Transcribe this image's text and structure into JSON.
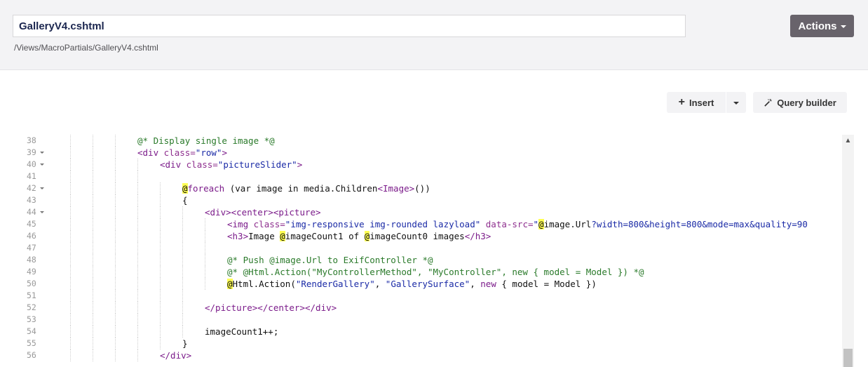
{
  "header": {
    "file_name": "GalleryV4.cshtml",
    "path": "/Views/MacroPartials/GalleryV4.cshtml",
    "actions_label": "Actions"
  },
  "toolbar": {
    "insert_label": "Insert",
    "query_builder_label": "Query builder"
  },
  "colors": {
    "header_bg": "#f3f3f5",
    "actions_bg": "#68636b",
    "comment": "#2a7a2a",
    "tag": "#7b1b8a",
    "string": "#1a2aa6",
    "razor_highlight": "#ffff55"
  },
  "editor": {
    "lines": [
      {
        "num": "38",
        "fold": false,
        "indent": 3,
        "tokens": [
          {
            "t": "@* Display single image *@",
            "c": "com"
          }
        ]
      },
      {
        "num": "39",
        "fold": true,
        "indent": 3,
        "tokens": [
          {
            "t": "<div ",
            "c": "tag"
          },
          {
            "t": "class=",
            "c": "attr"
          },
          {
            "t": "\"row\"",
            "c": "str"
          },
          {
            "t": ">",
            "c": "tag"
          }
        ]
      },
      {
        "num": "40",
        "fold": true,
        "indent": 4,
        "tokens": [
          {
            "t": "<div ",
            "c": "tag"
          },
          {
            "t": "class=",
            "c": "attr"
          },
          {
            "t": "\"pictureSlider\"",
            "c": "str"
          },
          {
            "t": ">",
            "c": "tag"
          }
        ]
      },
      {
        "num": "41",
        "fold": false,
        "indent": 0,
        "tokens": []
      },
      {
        "num": "42",
        "fold": true,
        "indent": 5,
        "tokens": [
          {
            "t": "@",
            "c": "razor"
          },
          {
            "t": "foreach",
            "c": "kw"
          },
          {
            "t": " (var image in media.Children",
            "c": "plain"
          },
          {
            "t": "<Image>",
            "c": "tag"
          },
          {
            "t": "())",
            "c": "plain"
          }
        ]
      },
      {
        "num": "43",
        "fold": false,
        "indent": 5,
        "tokens": [
          {
            "t": "{",
            "c": "plain"
          }
        ]
      },
      {
        "num": "44",
        "fold": true,
        "indent": 6,
        "tokens": [
          {
            "t": "<div><center><picture>",
            "c": "tag"
          }
        ]
      },
      {
        "num": "45",
        "fold": false,
        "indent": 7,
        "tokens": [
          {
            "t": "<img ",
            "c": "tag"
          },
          {
            "t": "class=",
            "c": "attr"
          },
          {
            "t": "\"img-responsive img-rounded lazyload\"",
            "c": "str"
          },
          {
            "t": " data-src=",
            "c": "attr"
          },
          {
            "t": "\"",
            "c": "str"
          },
          {
            "t": "@",
            "c": "razor"
          },
          {
            "t": "image.Url",
            "c": "plain"
          },
          {
            "t": "?width=800&height=800&mode=max&quality=90",
            "c": "str"
          }
        ]
      },
      {
        "num": "46",
        "fold": false,
        "indent": 7,
        "tokens": [
          {
            "t": "<h3>",
            "c": "tag"
          },
          {
            "t": "Image ",
            "c": "plain"
          },
          {
            "t": "@",
            "c": "razor"
          },
          {
            "t": "imageCount1 of ",
            "c": "plain"
          },
          {
            "t": "@",
            "c": "razor"
          },
          {
            "t": "imageCount0 images",
            "c": "plain"
          },
          {
            "t": "</h3>",
            "c": "tag"
          }
        ]
      },
      {
        "num": "47",
        "fold": false,
        "indent": 0,
        "tokens": []
      },
      {
        "num": "48",
        "fold": false,
        "indent": 7,
        "tokens": [
          {
            "t": "@* Push @image.Url to ExifController *@",
            "c": "com"
          }
        ]
      },
      {
        "num": "49",
        "fold": false,
        "indent": 7,
        "tokens": [
          {
            "t": "@* @Html.Action(\"MyControllerMethod\", \"MyController\", new { model = Model }) *@",
            "c": "com"
          }
        ]
      },
      {
        "num": "50",
        "fold": false,
        "indent": 7,
        "tokens": [
          {
            "t": "@",
            "c": "razor"
          },
          {
            "t": "Html.Action(",
            "c": "plain"
          },
          {
            "t": "\"RenderGallery\"",
            "c": "str"
          },
          {
            "t": ", ",
            "c": "plain"
          },
          {
            "t": "\"GallerySurface\"",
            "c": "str"
          },
          {
            "t": ", ",
            "c": "plain"
          },
          {
            "t": "new",
            "c": "kw"
          },
          {
            "t": " { model = Model })",
            "c": "plain"
          }
        ]
      },
      {
        "num": "51",
        "fold": false,
        "indent": 0,
        "tokens": []
      },
      {
        "num": "52",
        "fold": false,
        "indent": 6,
        "tokens": [
          {
            "t": "</picture></center></div>",
            "c": "tag"
          }
        ]
      },
      {
        "num": "53",
        "fold": false,
        "indent": 0,
        "tokens": []
      },
      {
        "num": "54",
        "fold": false,
        "indent": 6,
        "tokens": [
          {
            "t": "imageCount1++;",
            "c": "plain"
          }
        ]
      },
      {
        "num": "55",
        "fold": false,
        "indent": 5,
        "tokens": [
          {
            "t": "}",
            "c": "plain"
          }
        ]
      },
      {
        "num": "56",
        "fold": false,
        "indent": 4,
        "tokens": [
          {
            "t": "</div>",
            "c": "tag"
          }
        ]
      }
    ]
  }
}
